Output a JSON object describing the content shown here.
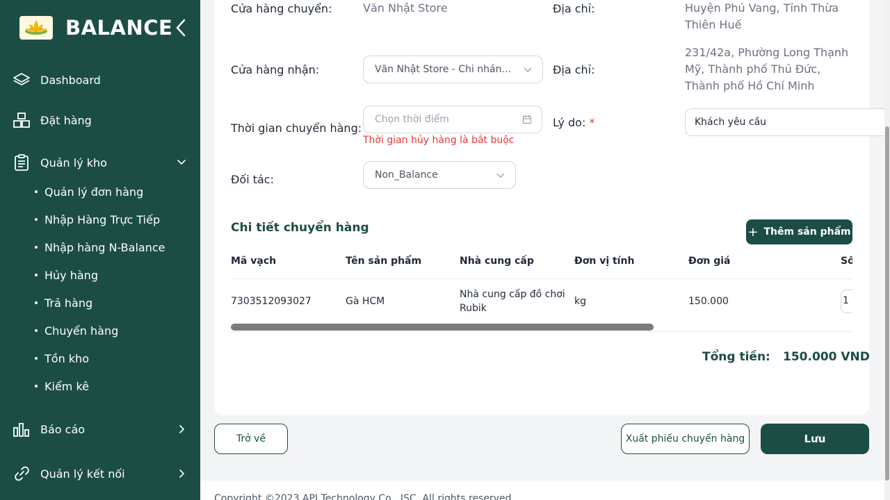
{
  "brand": {
    "name": "BALANCE",
    "logo_icon": "lotus-logo-icon"
  },
  "sidebar": {
    "items": [
      {
        "label": "Dashboard",
        "icon": "layers-icon"
      },
      {
        "label": "Đặt hàng",
        "icon": "boxes-icon"
      },
      {
        "label": "Quản lý kho",
        "icon": "clipboard-icon",
        "expanded": true,
        "children": [
          "Quản lý đơn hàng",
          "Nhập Hàng Trực Tiếp",
          "Nhập hàng N-Balance",
          "Hủy hàng",
          "Trả hàng",
          "Chuyển hàng",
          "Tồn kho",
          "Kiểm kê"
        ]
      },
      {
        "label": "Báo cáo",
        "icon": "bar-chart-icon"
      },
      {
        "label": "Quản lý kết nối",
        "icon": "link-icon"
      }
    ]
  },
  "form": {
    "from_store_label": "Cửa hàng chuyển:",
    "from_store_value": "Văn Nhật Store",
    "from_address_label": "Địa chỉ:",
    "from_address_value": "Huyện Phú Vang, Tỉnh Thừa Thiên Huế",
    "to_store_label": "Cửa hàng nhận:",
    "to_store_value": "Văn Nhật Store - Chi nhánh ...",
    "to_address_label": "Địa chỉ:",
    "to_address_value": "231/42a, Phường Long Thạnh Mỹ, Thành phố Thủ Đức, Thành phố Hồ Chí Minh",
    "time_label": "Thời gian chuyển hàng:",
    "time_placeholder": "Chọn thời điểm",
    "time_error": "Thời gian hủy hàng là bắt buộc",
    "reason_label": "Lý do:",
    "reason_required": "*",
    "reason_value": "Khách yêu cầu",
    "partner_label": "Đối tác:",
    "partner_value": "Non_Balance"
  },
  "details": {
    "title": "Chi tiết chuyển hàng",
    "add_button": "Thêm sản phẩm",
    "columns": [
      "Mã vạch",
      "Tên sản phẩm",
      "Nhà cung cấp",
      "Đơn vị tính",
      "Đơn giá",
      "Số"
    ],
    "rows": [
      {
        "barcode": "7303512093027",
        "name": "Gà HCM",
        "supplier": "Nhà cung cấp đồ chơi Rubik",
        "unit": "kg",
        "price": "150.000",
        "qty": "1"
      }
    ],
    "scroll_position": 0.68
  },
  "total": {
    "label": "Tổng tiền:",
    "value": "150.000 VND"
  },
  "actions": {
    "back": "Trở về",
    "export": "Xuất phiếu chuyển hàng",
    "save": "Lưu"
  },
  "footer": {
    "copyright": "Copyright ©2023 API Technology Co., JSC. All rights reserved."
  },
  "colors": {
    "primary": "#1b4d45",
    "error": "#e53935"
  }
}
